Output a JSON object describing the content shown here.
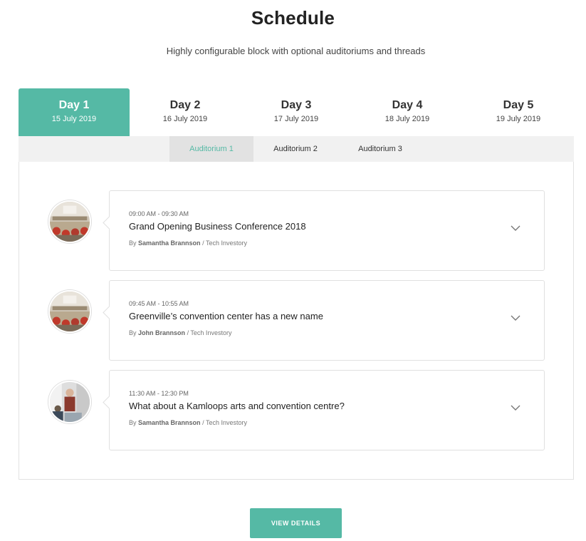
{
  "header": {
    "title": "Schedule",
    "subtitle": "Highly configurable block with optional auditoriums and threads"
  },
  "days": [
    {
      "name": "Day 1",
      "date": "15 July 2019",
      "active": true
    },
    {
      "name": "Day 2",
      "date": "16 July 2019",
      "active": false
    },
    {
      "name": "Day 3",
      "date": "17 July 2019",
      "active": false
    },
    {
      "name": "Day 4",
      "date": "18 July 2019",
      "active": false
    },
    {
      "name": "Day 5",
      "date": "19 July 2019",
      "active": false
    }
  ],
  "auditoriums": [
    {
      "label": "Auditorium 1",
      "active": true
    },
    {
      "label": "Auditorium 2",
      "active": false
    },
    {
      "label": "Auditorium 3",
      "active": false
    }
  ],
  "events": [
    {
      "time": "09:00 AM - 09:30 AM",
      "title": "Grand Opening Business Conference 2018",
      "by": "By",
      "speaker": "Samantha Brannson",
      "separator": "/",
      "company": "Tech Investory",
      "icon": "conference-room-photo"
    },
    {
      "time": "09:45 AM - 10:55 AM",
      "title": "Greenville’s convention center has a new name",
      "by": "By",
      "speaker": "John Brannson",
      "separator": "/",
      "company": "Tech Investory",
      "icon": "conference-room-photo"
    },
    {
      "time": "11:30 AM - 12:30 PM",
      "title": "What about a Kamloops arts and convention centre?",
      "by": "By",
      "speaker": "Samantha Brannson",
      "separator": "/",
      "company": "Tech Investory",
      "icon": "office-people-photo"
    }
  ],
  "cta": {
    "label": "VIEW DETAILS"
  },
  "colors": {
    "accent": "#55b9a5",
    "tab_bar": "#f1f1f1",
    "tab_active": "#e2e2e2"
  }
}
